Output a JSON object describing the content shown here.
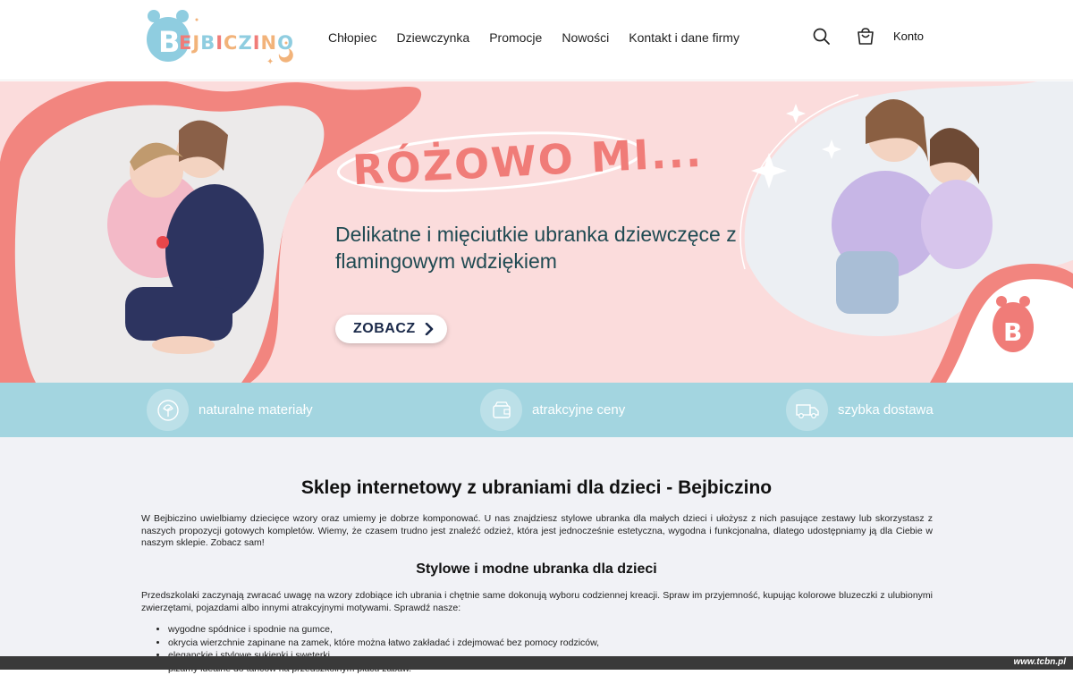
{
  "header": {
    "logo_text": "BEJBICZINO",
    "nav": [
      "Chłopiec",
      "Dziewczynka",
      "Promocje",
      "Nowości",
      "Kontakt i dane firmy"
    ],
    "account": "Konto",
    "icons": [
      "search-icon",
      "cart-icon"
    ]
  },
  "hero": {
    "title": "RÓŻOWO MI...",
    "subtitle": "Delikatne i mięciutkie ubranka dziewczęce z flamingowym wdziękiem",
    "button": "ZOBACZ"
  },
  "features": [
    {
      "label": "naturalne materiały",
      "icon": "leaf-icon"
    },
    {
      "label": "atrakcyjne ceny",
      "icon": "wallet-icon"
    },
    {
      "label": "szybka dostawa",
      "icon": "truck-icon"
    }
  ],
  "content": {
    "heading": "Sklep internetowy z ubraniami dla dzieci - Bejbiczino",
    "paragraph1": "W Bejbiczino uwielbiamy dziecięce wzory oraz umiemy je dobrze komponować. U nas znajdziesz stylowe ubranka dla małych dzieci i ułożysz z nich pasujące zestawy lub skorzystasz z naszych propozycji gotowych kompletów. Wiemy, że czasem trudno jest znaleźć odzież, która jest jednocześnie estetyczna, wygodna i funkcjonalna, dlatego udostępniamy ją dla Ciebie w naszym sklepie. Zobacz sam!",
    "subheading": "Stylowe i modne ubranka dla dzieci",
    "paragraph2": "Przedszkolaki zaczynają zwracać uwagę na wzory zdobiące ich ubrania i chętnie same dokonują wyboru codziennej kreacji. Spraw im przyjemność, kupując kolorowe bluzeczki z ulubionymi zwierzętami, pojazdami albo innymi atrakcyjnymi motywami. Sprawdź nasze:",
    "list": [
      "wygodne spódnice i spodnie na gumce,",
      "okrycia wierzchnie zapinane na zamek, które można łatwo zakładać i zdejmować bez pomocy rodziców,",
      "eleganckie i stylowe sukienki i sweterki,",
      "piżamy idealne do tańców na przedszkolnym placu zabaw."
    ]
  },
  "watermark": "www.tcbn.pl",
  "colors": {
    "hero_bg": "#fbdcdc",
    "coral": "#f07c78",
    "feature_bar": "#a3d5e0",
    "content_bg": "#f1f2f6"
  }
}
